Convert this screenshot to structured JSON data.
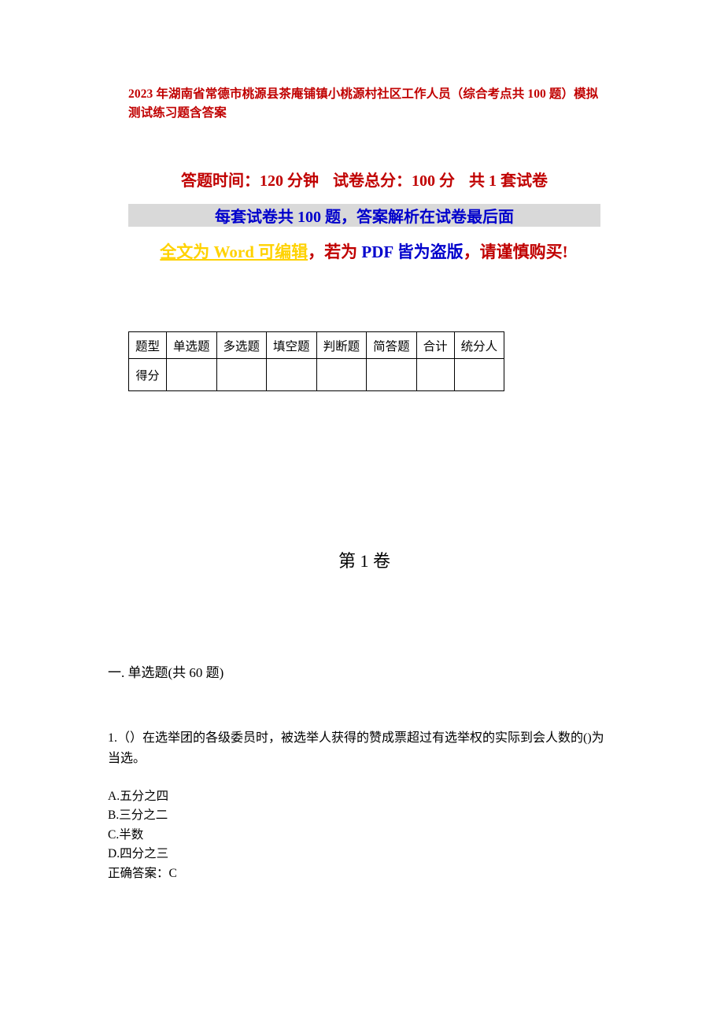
{
  "document": {
    "title": "2023 年湖南省常德市桃源县茶庵铺镇小桃源村社区工作人员（综合考点共 100 题）模拟测试练习题含答案",
    "header_line1": {
      "part1": "答题时间：120 分钟",
      "part2": "试卷总分：100 分",
      "part3": "共 1 套试卷"
    },
    "header_line2": "每套试卷共 100 题，答案解析在试卷最后面",
    "header_line3": {
      "seg_a": "全文为 Word 可编辑",
      "seg_b": "，若为 ",
      "seg_c": "PDF 皆为盗版",
      "seg_d": "，请谨慎购买!"
    },
    "score_table": {
      "headers": [
        "题型",
        "单选题",
        "多选题",
        "填空题",
        "判断题",
        "简答题",
        "合计",
        "统分人"
      ],
      "rows": [
        [
          "得分",
          "",
          "",
          "",
          "",
          "",
          "",
          ""
        ]
      ]
    },
    "volume_label": "第 1 卷",
    "section_heading": "一. 单选题(共 60 题)",
    "question": {
      "stem": "1.（）在选举团的各级委员时，被选举人获得的赞成票超过有选举权的实际到会人数的()为当选。",
      "options": [
        "A.五分之四",
        "B.三分之二",
        "C.半数",
        "D.四分之三"
      ],
      "answer_line": "正确答案：C"
    }
  }
}
